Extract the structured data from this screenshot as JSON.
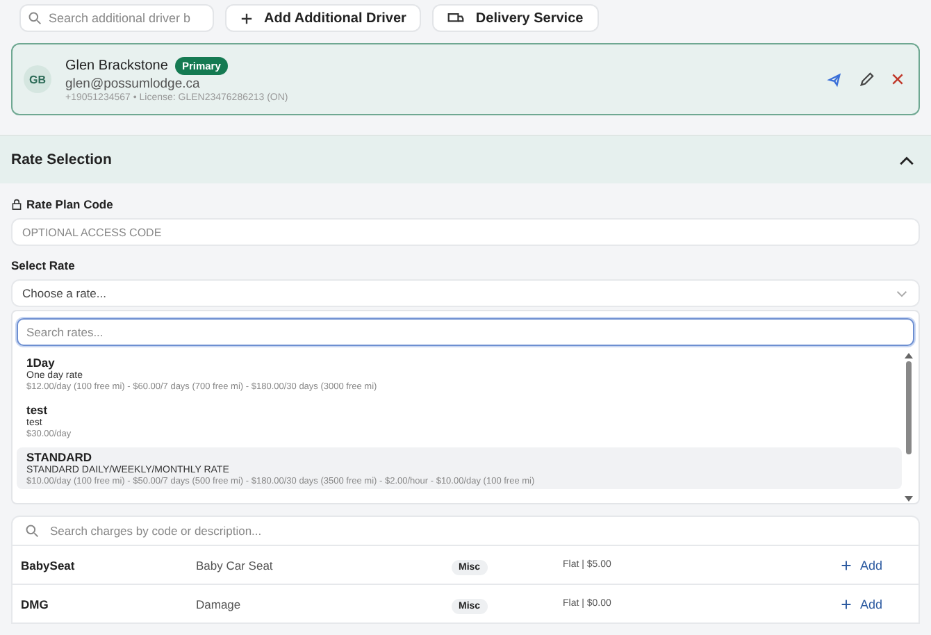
{
  "toolbar": {
    "search": {
      "placeholder": "Search additional driver b"
    },
    "buttons": [
      {
        "kind": "add",
        "label": "Add Additional Driver"
      },
      {
        "kind": "delivery",
        "label": "Delivery Service"
      }
    ]
  },
  "driver": {
    "initials": "GB",
    "name": "Glen Brackstone",
    "badge": "Primary",
    "email": "glen@possumlodge.ca",
    "details": "+19051234567 • License: GLEN23476286213 (ON)"
  },
  "rate_selection": {
    "title": "Rate Selection",
    "expanded": true,
    "plan_code": {
      "label": "Rate Plan Code",
      "placeholder": "OPTIONAL ACCESS CODE"
    },
    "select": {
      "label": "Select Rate",
      "placeholder": "Choose a rate...",
      "expanded": true,
      "search_placeholder": "Search rates...",
      "options": [
        {
          "name": "1Day",
          "description": "One day rate",
          "pricing": "$12.00/day (100 free mi) - $60.00/7 days (700 free mi) - $180.00/30 days (3000 free mi)",
          "selected": false
        },
        {
          "name": "test",
          "description": "test",
          "pricing": "$30.00/day",
          "selected": false
        },
        {
          "name": "STANDARD",
          "description": "STANDARD DAILY/WEEKLY/MONTHLY RATE",
          "pricing": "$10.00/day (100 free mi) - $50.00/7 days (500 free mi) - $180.00/30 days (3500 free mi) - $2.00/hour - $10.00/day (100 free mi)",
          "selected": true
        }
      ]
    }
  },
  "charges": {
    "search": {
      "placeholder": "Search charges by code or description..."
    },
    "rows": [
      {
        "code": "BabySeat",
        "description": "Baby Car Seat",
        "category": "Misc",
        "price": "Flat | $5.00",
        "action": "Add"
      },
      {
        "code": "DMG",
        "description": "Damage",
        "category": "Misc",
        "price": "Flat | $0.00",
        "action": "Add"
      }
    ]
  }
}
